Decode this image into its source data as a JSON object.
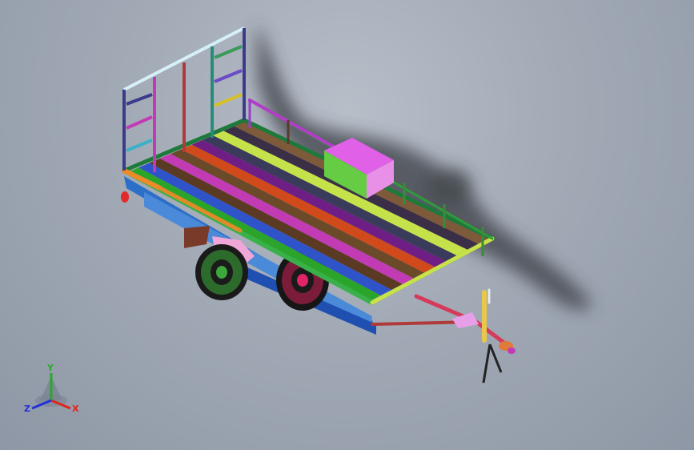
{
  "viewport": {
    "model_type": "utility trailer assembly",
    "background_top": "#b7bec8",
    "background_bottom": "#8e97a5"
  },
  "deck_board_colors": [
    "#2aa52a",
    "#2f53c8",
    "#5b3a23",
    "#c23bb5",
    "#6b4a2a",
    "#d04a1b",
    "#6e1e84",
    "#3a3a5a",
    "#c6e24a",
    "#3b2f48",
    "#7d5a3a"
  ],
  "triad": {
    "x_label": "X",
    "y_label": "Y",
    "z_label": "Z",
    "x_color": "#e0241b",
    "y_color": "#2aa82a",
    "z_color": "#2430d8"
  }
}
